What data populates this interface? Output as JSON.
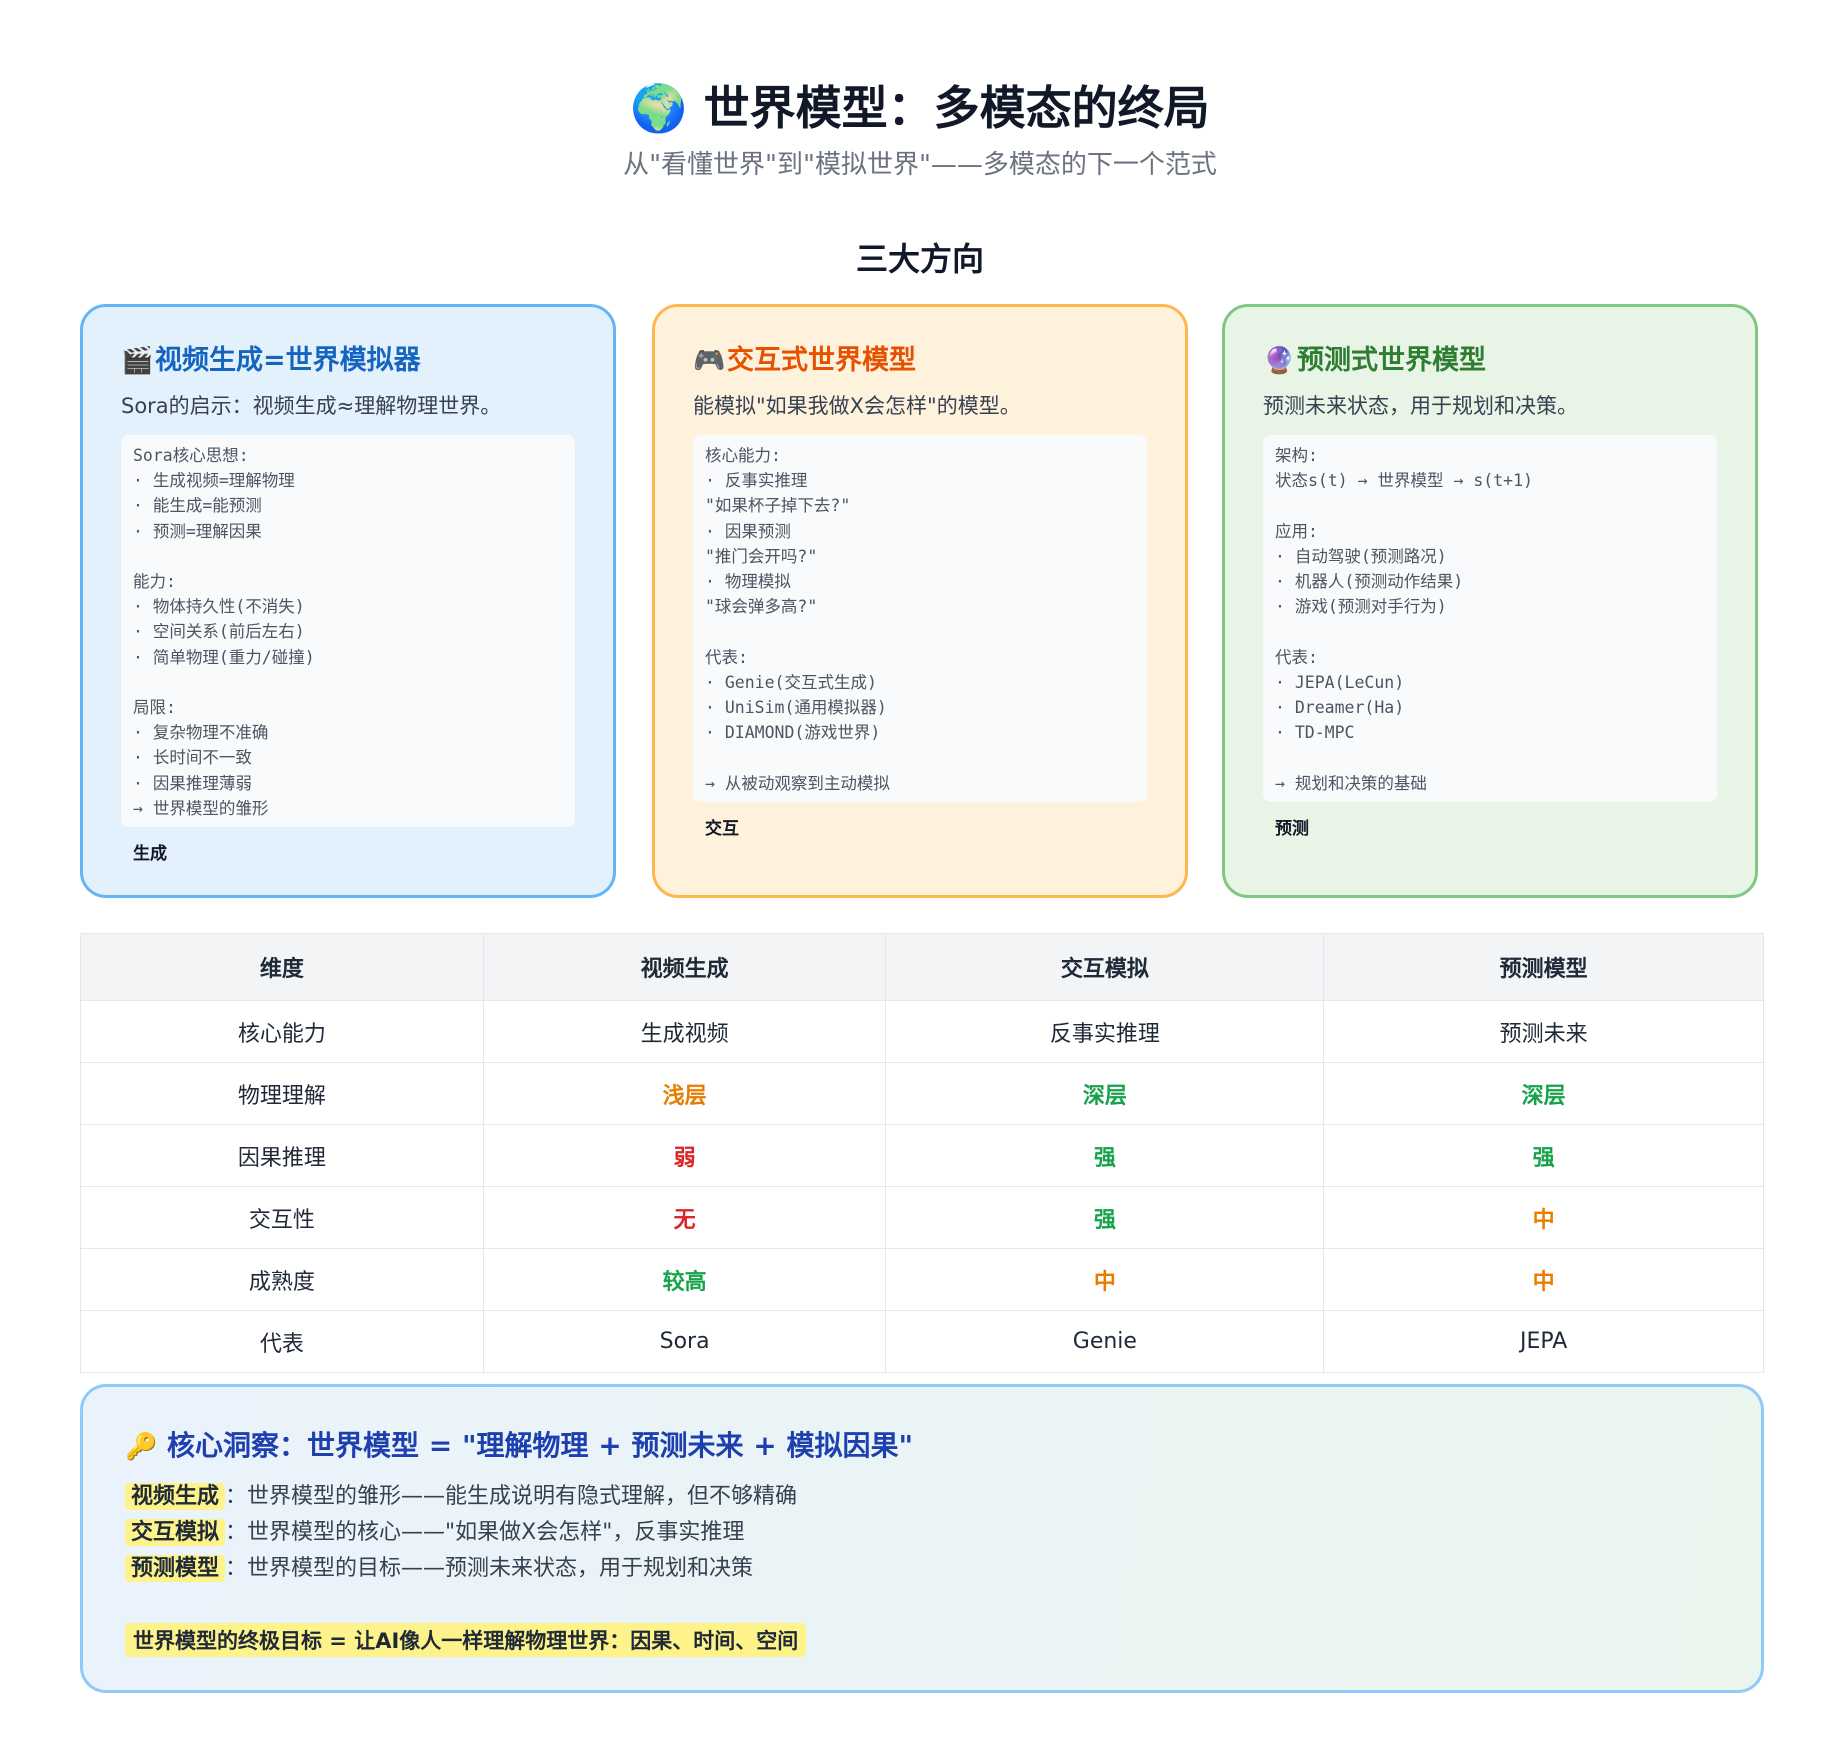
{
  "header": {
    "icon": "globe-icon",
    "emoji": "🌍",
    "title": "世界模型：多模态的终局",
    "subtitle": "从\"看懂世界\"到\"模拟世界\"——多模态的下一个范式"
  },
  "section_title": "三大方向",
  "cards": [
    {
      "icon": "clapper-board-icon",
      "emoji": "🎬",
      "title": "视频生成=世界模拟器",
      "desc": "Sora的启示：视频生成≈理解物理世界。",
      "body": "Sora核心思想:\n· 生成视频=理解物理\n· 能生成=能预测\n· 预测=理解因果\n\n能力:\n· 物体持久性(不消失)\n· 空间关系(前后左右)\n· 简单物理(重力/碰撞)\n\n局限:\n· 复杂物理不准确\n· 长时间不一致\n· 因果推理薄弱\n→ 世界模型的雏形",
      "tag": "生成",
      "color": "#1565c0"
    },
    {
      "icon": "game-controller-icon",
      "emoji": "🎮",
      "title": "交互式世界模型",
      "desc": "能模拟\"如果我做X会怎样\"的模型。",
      "body": "核心能力:\n· 反事实推理\n\"如果杯子掉下去?\"\n· 因果预测\n\"推门会开吗?\"\n· 物理模拟\n\"球会弹多高?\"\n\n代表:\n· Genie(交互式生成)\n· UniSim(通用模拟器)\n· DIAMOND(游戏世界)\n\n→ 从被动观察到主动模拟",
      "tag": "交互",
      "color": "#e65100"
    },
    {
      "icon": "crystal-ball-icon",
      "emoji": "🔮",
      "title": "预测式世界模型",
      "desc": "预测未来状态，用于规划和决策。",
      "body": "架构:\n状态s(t) → 世界模型 → s(t+1)\n\n应用:\n· 自动驾驶(预测路况)\n· 机器人(预测动作结果)\n· 游戏(预测对手行为)\n\n代表:\n· JEPA(LeCun)\n· Dreamer(Ha)\n· TD-MPC\n\n→ 规划和决策的基础",
      "tag": "预测",
      "color": "#2e7d32"
    }
  ],
  "table": {
    "headers": [
      "维度",
      "视频生成",
      "交互模拟",
      "预测模型"
    ],
    "rows": [
      [
        {
          "text": "核心能力"
        },
        {
          "text": "生成视频"
        },
        {
          "text": "反事实推理"
        },
        {
          "text": "预测未来"
        }
      ],
      [
        {
          "text": "物理理解"
        },
        {
          "text": "浅层",
          "tone": "orange"
        },
        {
          "text": "深层",
          "tone": "green"
        },
        {
          "text": "深层",
          "tone": "green"
        }
      ],
      [
        {
          "text": "因果推理"
        },
        {
          "text": "弱",
          "tone": "red"
        },
        {
          "text": "强",
          "tone": "green"
        },
        {
          "text": "强",
          "tone": "green"
        }
      ],
      [
        {
          "text": "交互性"
        },
        {
          "text": "无",
          "tone": "red"
        },
        {
          "text": "强",
          "tone": "green"
        },
        {
          "text": "中",
          "tone": "orange"
        }
      ],
      [
        {
          "text": "成熟度"
        },
        {
          "text": "较高",
          "tone": "green"
        },
        {
          "text": "中",
          "tone": "orange"
        },
        {
          "text": "中",
          "tone": "orange"
        }
      ],
      [
        {
          "text": "代表"
        },
        {
          "text": "Sora"
        },
        {
          "text": "Genie"
        },
        {
          "text": "JEPA"
        }
      ]
    ]
  },
  "insight": {
    "icon": "key-icon",
    "emoji": "🔑",
    "title": "核心洞察：世界模型 = \"理解物理 + 预测未来 + 模拟因果\"",
    "lines": [
      {
        "label": "视频生成",
        "text": "：世界模型的雏形——能生成说明有隐式理解，但不够精确"
      },
      {
        "label": "交互模拟",
        "text": "：世界模型的核心——\"如果做X会怎样\"，反事实推理"
      },
      {
        "label": "预测模型",
        "text": "：世界模型的目标——预测未来状态，用于规划和决策"
      }
    ],
    "goal": "世界模型的终极目标 = 让AI像人一样理解物理世界：因果、时间、空间"
  },
  "colors": {
    "orange": "#e67e00",
    "green": "#16a34a",
    "red": "#dc2626",
    "highlight": "#fdf38a"
  }
}
